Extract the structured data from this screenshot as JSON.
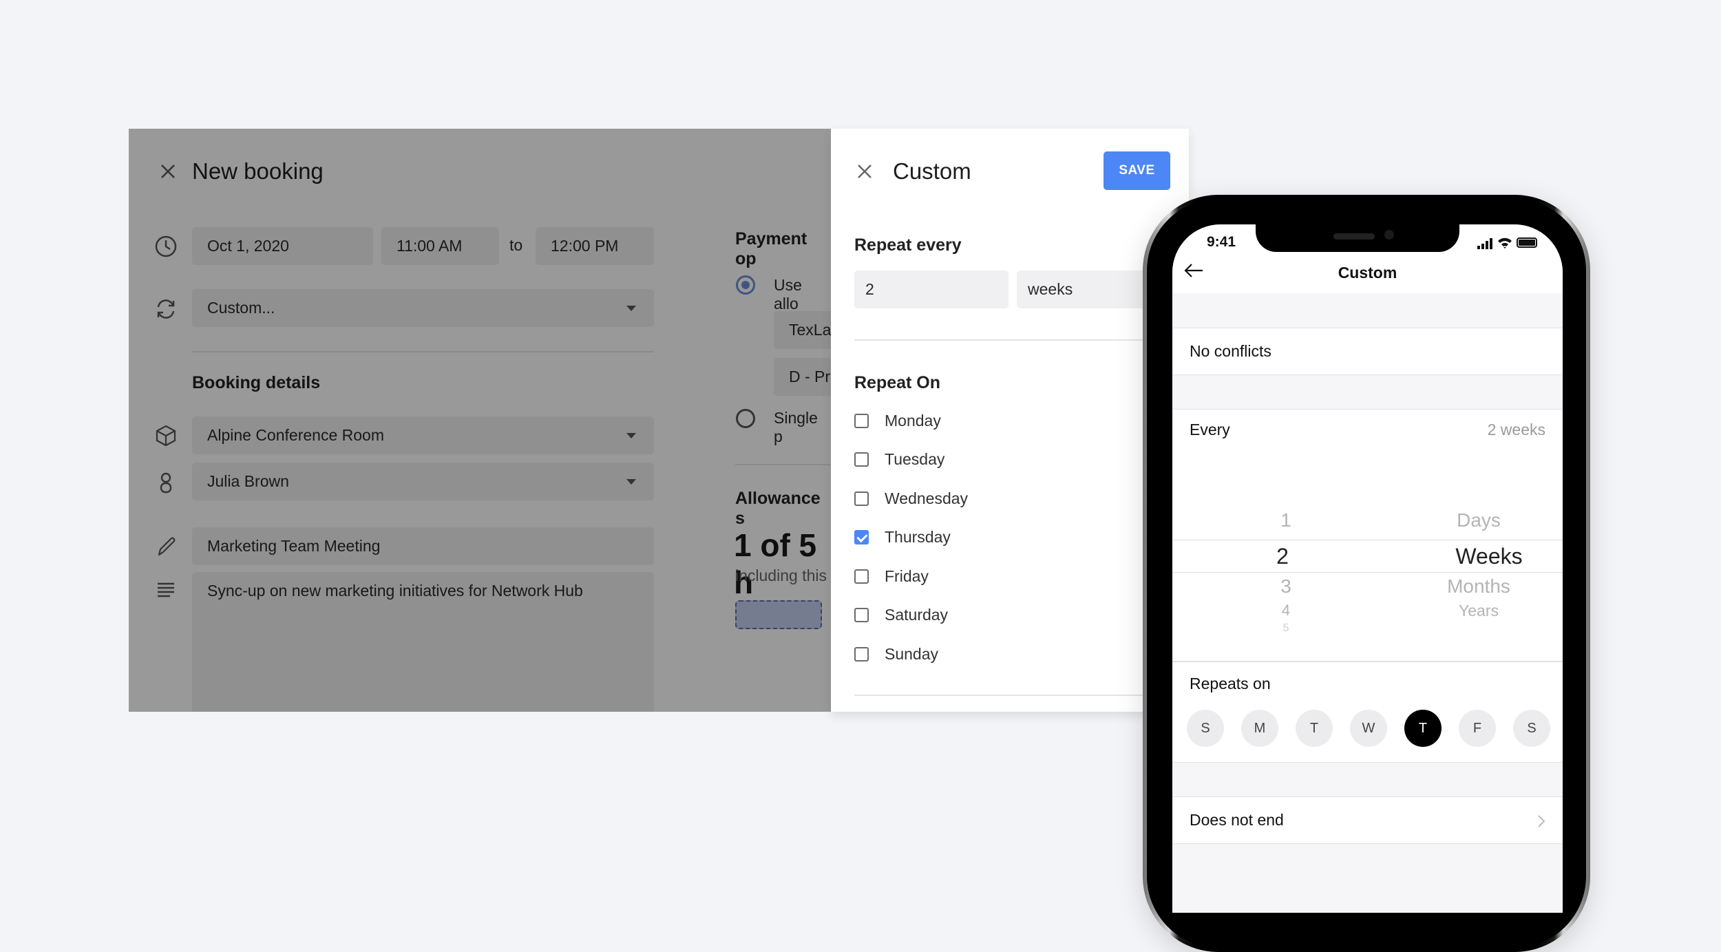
{
  "booking": {
    "title": "New booking",
    "date": "Oct 1, 2020",
    "start_time": "11:00 AM",
    "to_label": "to",
    "end_time": "12:00 PM",
    "recurrence": "Custom...",
    "details_heading": "Booking details",
    "resource": "Alpine Conference Room",
    "host": "Julia Brown",
    "meeting_title": "Marketing Team Meeting",
    "description": "Sync-up on new marketing initiatives for Network Hub",
    "payment": {
      "heading": "Payment op",
      "option_allowance": "Use allo",
      "allowance_field_1": "TexLab",
      "allowance_field_2": "D - Pri",
      "option_single": "Single p"
    },
    "allowance": {
      "heading": "Allowance s",
      "usage": "1 of 5 h",
      "sub": "including this"
    }
  },
  "custom_panel": {
    "title": "Custom",
    "save_label": "SAVE",
    "repeat_every_heading": "Repeat every",
    "interval_value": "2",
    "interval_unit": "weeks",
    "repeat_on_heading": "Repeat On",
    "days": [
      {
        "label": "Monday",
        "checked": false
      },
      {
        "label": "Tuesday",
        "checked": false
      },
      {
        "label": "Wednesday",
        "checked": false
      },
      {
        "label": "Thursday",
        "checked": true
      },
      {
        "label": "Friday",
        "checked": false
      },
      {
        "label": "Saturday",
        "checked": false
      },
      {
        "label": "Sunday",
        "checked": false
      }
    ],
    "accent_color": "#4c87f5"
  },
  "phone": {
    "status_time": "9:41",
    "nav_title": "Custom",
    "conflicts": "No conflicts",
    "every_label": "Every",
    "every_value": "2 weeks",
    "picker_numbers": [
      "1",
      "2",
      "3",
      "4",
      "5"
    ],
    "picker_selected_number": "2",
    "picker_units": [
      "Days",
      "Weeks",
      "Months",
      "Years"
    ],
    "picker_selected_unit": "Weeks",
    "repeats_on_label": "Repeats on",
    "weekdays": [
      {
        "label": "S",
        "selected": false
      },
      {
        "label": "M",
        "selected": false
      },
      {
        "label": "T",
        "selected": false
      },
      {
        "label": "W",
        "selected": false
      },
      {
        "label": "T",
        "selected": true
      },
      {
        "label": "F",
        "selected": false
      },
      {
        "label": "S",
        "selected": false
      }
    ],
    "end_label": "Does not end"
  }
}
